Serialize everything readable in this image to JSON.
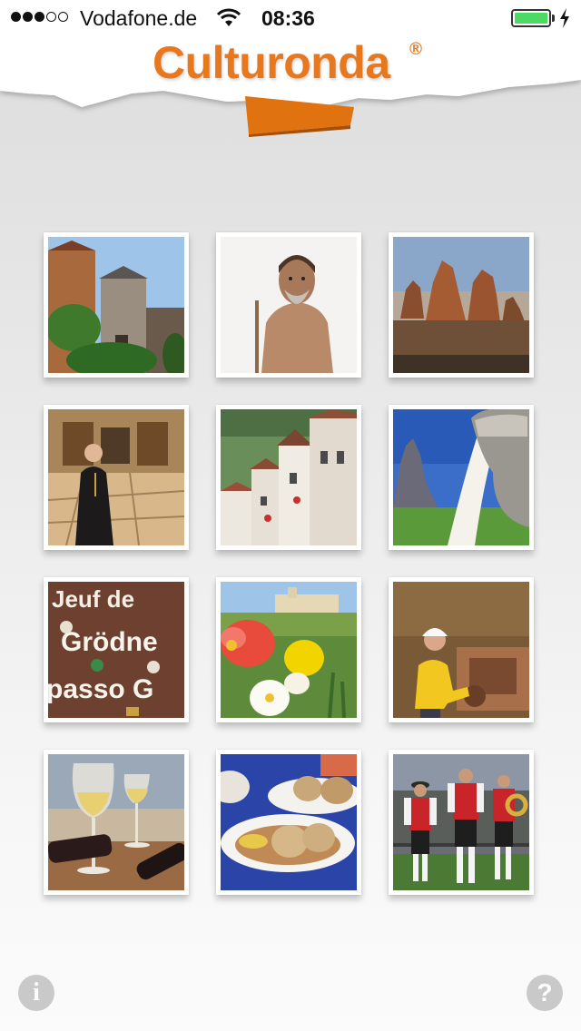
{
  "status_bar": {
    "carrier": "Vodafone.de",
    "time": "08:36",
    "signal_bars_filled": 3,
    "signal_bars_total": 5,
    "battery_level": 1.0,
    "charging": true
  },
  "header": {
    "app_name": "Culturonda",
    "registered_mark": "®",
    "brand_color": "#e8781e"
  },
  "tiles": [
    {
      "name": "tile-castle",
      "icon": "castle-photo"
    },
    {
      "name": "tile-iceman",
      "icon": "iceman-photo"
    },
    {
      "name": "tile-mountains",
      "icon": "dolomites-photo"
    },
    {
      "name": "tile-monk",
      "icon": "monk-library-photo"
    },
    {
      "name": "tile-village",
      "icon": "village-houses-photo"
    },
    {
      "name": "tile-milk",
      "icon": "milk-pour-photo"
    },
    {
      "name": "tile-language",
      "icon": "signs-photo"
    },
    {
      "name": "tile-garden",
      "icon": "flower-garden-photo"
    },
    {
      "name": "tile-mining",
      "icon": "miner-photo"
    },
    {
      "name": "tile-wine",
      "icon": "wine-photo"
    },
    {
      "name": "tile-food",
      "icon": "dumplings-photo"
    },
    {
      "name": "tile-music",
      "icon": "band-photo"
    }
  ],
  "signs_tile_text": {
    "line1": "Jeuf de",
    "line2": "Grödne",
    "line3": "passo G"
  },
  "footer": {
    "info_glyph": "i",
    "help_glyph": "?"
  }
}
